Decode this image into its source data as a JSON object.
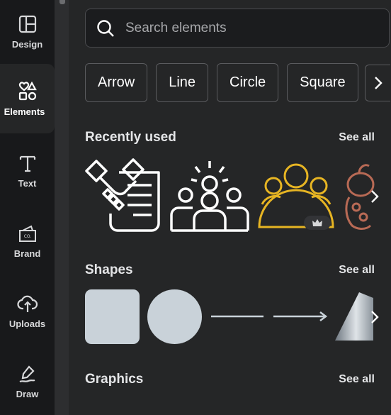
{
  "rail": {
    "items": [
      {
        "label": "Design",
        "icon": "design-icon"
      },
      {
        "label": "Elements",
        "icon": "elements-icon"
      },
      {
        "label": "Text",
        "icon": "text-icon"
      },
      {
        "label": "Brand",
        "icon": "brand-icon"
      },
      {
        "label": "Uploads",
        "icon": "uploads-icon"
      },
      {
        "label": "Draw",
        "icon": "draw-icon"
      }
    ],
    "active": "Elements"
  },
  "search": {
    "placeholder": "Search elements",
    "value": ""
  },
  "chips": [
    "Arrow",
    "Line",
    "Circle",
    "Square"
  ],
  "sections": {
    "recently_used": {
      "title": "Recently used",
      "see_all": "See all",
      "items": [
        "handshake-contract-icon",
        "team-idea-icon",
        "crown-group-icon",
        "character-icon"
      ]
    },
    "shapes": {
      "title": "Shapes",
      "see_all": "See all",
      "items": [
        "rounded-square-shape",
        "circle-shape",
        "line-shape",
        "arrow-line-shape",
        "cone-shape"
      ]
    },
    "graphics": {
      "title": "Graphics",
      "see_all": "See all"
    }
  },
  "colors": {
    "bg": "#252627",
    "rail": "#18191b",
    "shape_fill": "#c9d2d9",
    "gold": "#e7b523"
  }
}
